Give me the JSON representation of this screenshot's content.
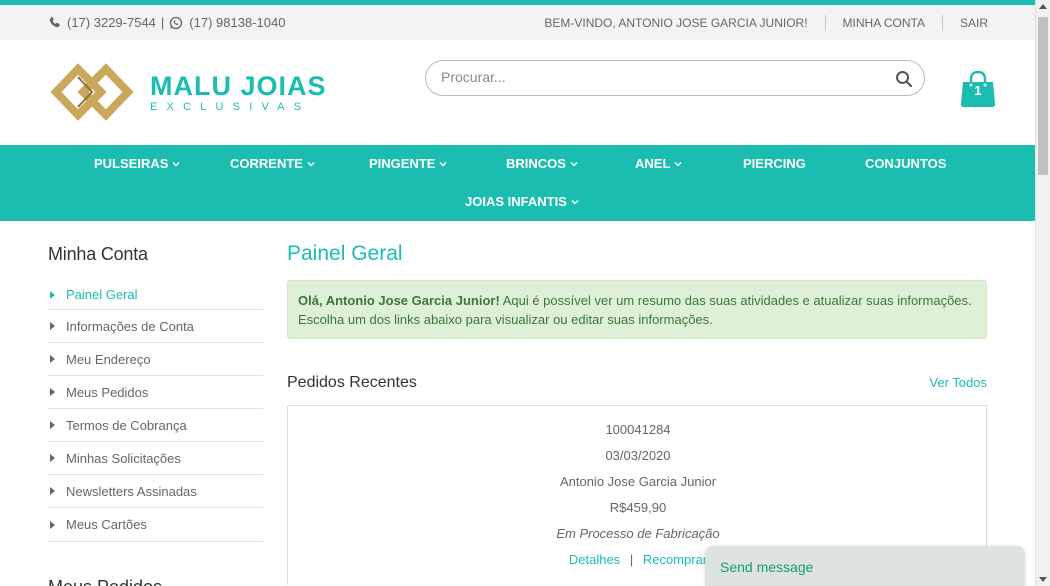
{
  "topbar": {
    "phone": "(17) 3229-7544",
    "separator": "|",
    "whatsapp": "(17) 98138-1040",
    "welcome": "BEM-VINDO, ANTONIO JOSE GARCIA JUNIOR!",
    "my_account": "MINHA CONTA",
    "logout": "SAIR"
  },
  "logo": {
    "title": "MALU JOIAS",
    "subtitle": "EXCLUSIVAS"
  },
  "search": {
    "placeholder": "Procurar..."
  },
  "cart": {
    "count": "1"
  },
  "nav": {
    "items": [
      {
        "label": "PULSEIRAS",
        "dropdown": true
      },
      {
        "label": "CORRENTE",
        "dropdown": true
      },
      {
        "label": "PINGENTE",
        "dropdown": true
      },
      {
        "label": "BRINCOS",
        "dropdown": true
      },
      {
        "label": "ANEL",
        "dropdown": true
      },
      {
        "label": "PIERCING",
        "dropdown": false
      },
      {
        "label": "CONJUNTOS",
        "dropdown": false
      },
      {
        "label": "JOIAS INFANTIS",
        "dropdown": true
      }
    ]
  },
  "sidebar": {
    "title": "Minha Conta",
    "items": [
      {
        "label": "Painel Geral",
        "active": true
      },
      {
        "label": "Informações de Conta"
      },
      {
        "label": "Meu Endereço"
      },
      {
        "label": "Meus Pedidos"
      },
      {
        "label": "Termos de Cobrança"
      },
      {
        "label": "Minhas Solicitações"
      },
      {
        "label": "Newsletters Assinadas"
      },
      {
        "label": "Meus Cartões"
      }
    ],
    "next_heading": "Meus Pedidos"
  },
  "main": {
    "title": "Painel Geral",
    "welcome_name": "Olá, Antonio Jose Garcia Junior!",
    "welcome_text": "Aqui é possível ver um resumo das suas atividades e atualizar suas informações. Escolha um dos links abaixo para visualizar ou editar suas informações.",
    "recent_title": "Pedidos Recentes",
    "view_all": "Ver Todos",
    "order": {
      "number": "100041284",
      "date": "03/03/2020",
      "customer": "Antonio Jose Garcia Junior",
      "total": "R$459,90",
      "status": "Em Processo de Fabricação",
      "details_link": "Detalhes",
      "separator": "|",
      "reorder_link": "Recomprar"
    }
  },
  "chat": {
    "label": "Send message"
  },
  "colors": {
    "accent": "#1bbdb0",
    "logo_gold": "#c9a85c",
    "success_bg": "#dff0d8",
    "success_text": "#3c763d"
  },
  "icons": {
    "phone": "phone-icon",
    "whatsapp": "whatsapp-icon",
    "search": "search-icon",
    "cart": "shopping-bag-icon",
    "caret": "chevron-down-icon"
  }
}
